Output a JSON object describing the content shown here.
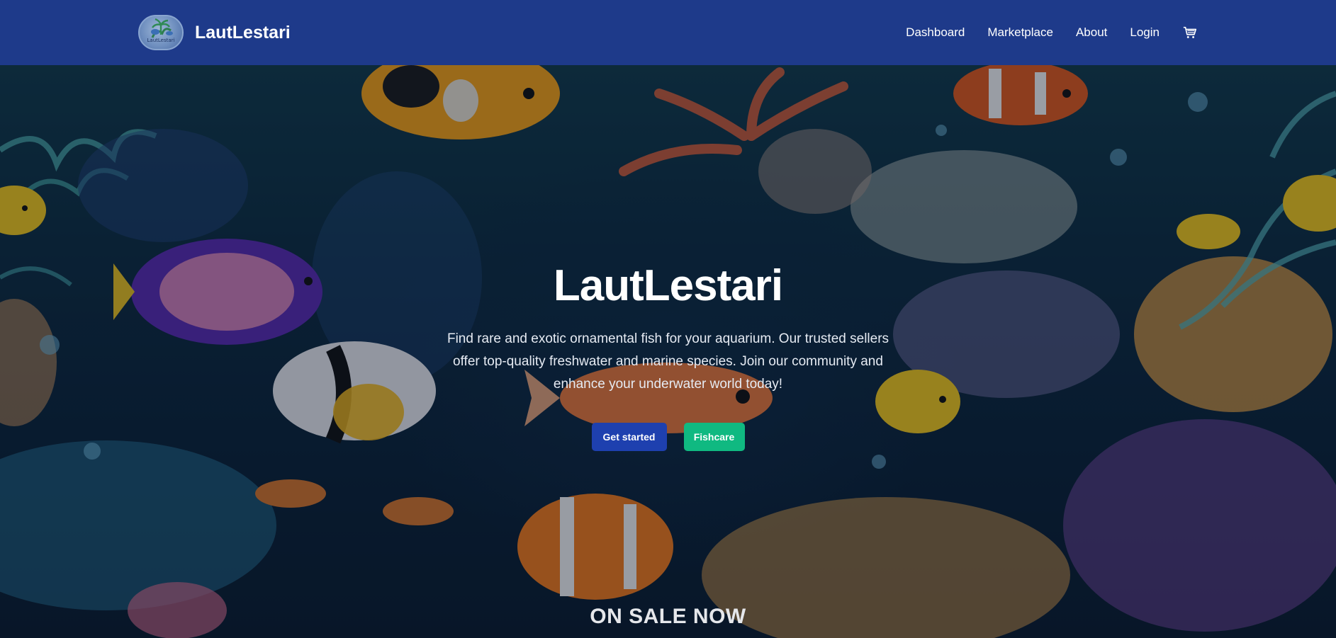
{
  "navbar": {
    "brand": "LautLestari",
    "logo_text": "LautLestari",
    "links": [
      "Dashboard",
      "Marketplace",
      "About",
      "Login"
    ],
    "cart_icon": "cart-icon",
    "background": "#1e3a8a"
  },
  "hero": {
    "title": "LautLestari",
    "description": "Find rare and exotic ornamental fish for your aquarium. Our trusted sellers offer top-quality freshwater and marine species. Join our community and enhance your underwater world today!",
    "buttons": {
      "primary": "Get started",
      "secondary": "Fishcare"
    },
    "colors": {
      "primary_button": "#1e40af",
      "secondary_button": "#10b981"
    }
  },
  "sale": {
    "heading": "ON SALE NOW"
  }
}
